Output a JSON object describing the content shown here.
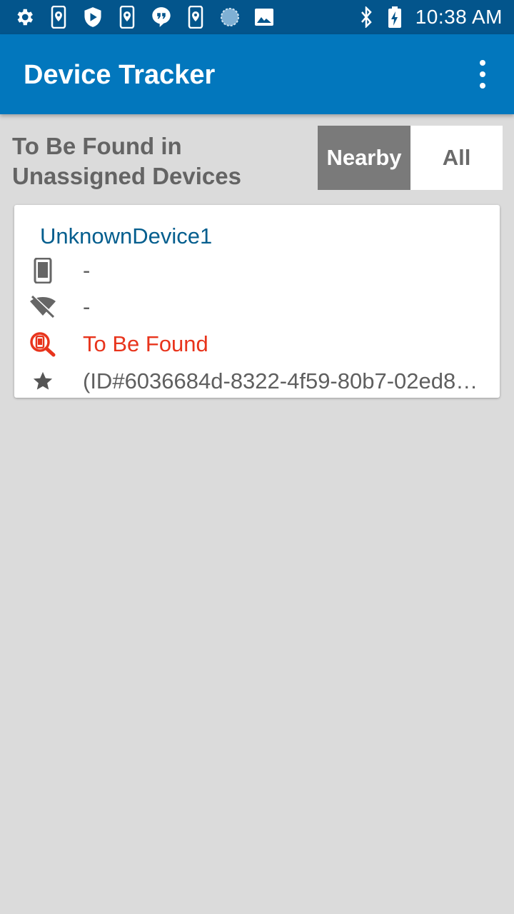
{
  "status_bar": {
    "left_icons": [
      "settings-icon",
      "location-phone-icon",
      "shield-play-icon",
      "location-phone-icon",
      "quote-bubble-icon",
      "location-phone-icon",
      "sync-circle-icon",
      "image-icon"
    ],
    "right_icons": [
      "bluetooth-icon",
      "battery-charging-icon"
    ],
    "time": "10:38 AM"
  },
  "app_bar": {
    "title": "Device Tracker",
    "overflow_icon": "more-vert-icon",
    "color": "#0277bd"
  },
  "filter": {
    "heading": "To Be Found in Unassigned Devices",
    "options": [
      {
        "label": "Nearby",
        "selected": true
      },
      {
        "label": "All",
        "selected": false
      }
    ]
  },
  "devices": [
    {
      "name": "UnknownDevice1",
      "model": "-",
      "connection": "-",
      "status": "To Be Found",
      "id_text": "(ID#6036684d-8322-4f59-80b7-02ed8b…"
    }
  ],
  "colors": {
    "status_bar": "#03558c",
    "background": "#dbdbdb",
    "device_name": "#045e8e",
    "status_to_be_found": "#e8341c",
    "selected_segment": "#7a7a7a"
  }
}
